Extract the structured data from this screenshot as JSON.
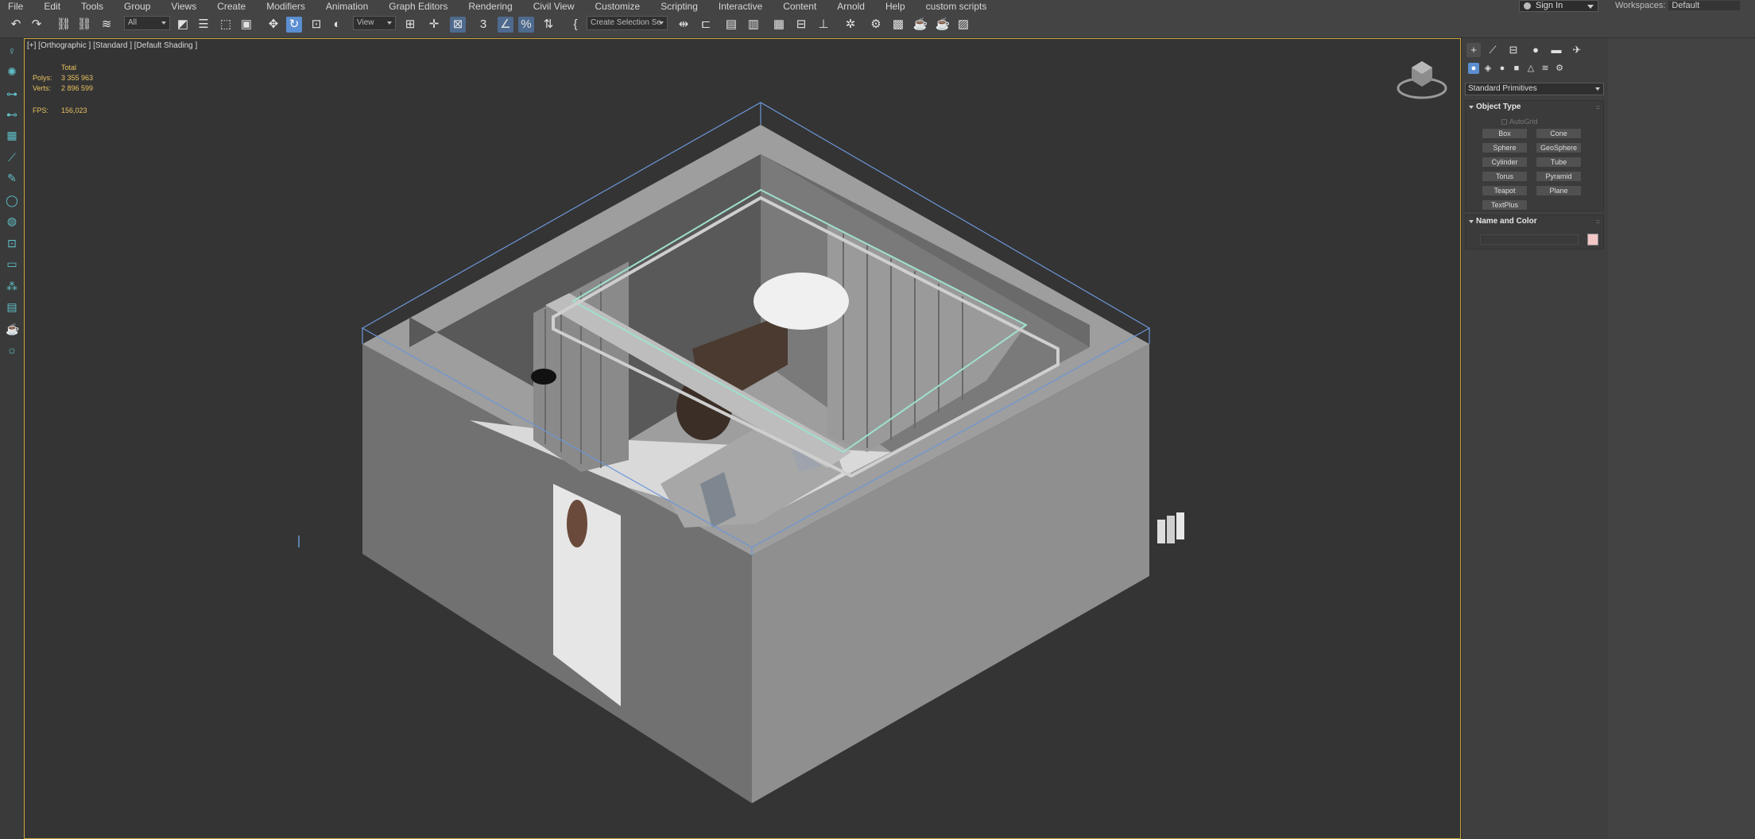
{
  "menu": [
    "File",
    "Edit",
    "Tools",
    "Group",
    "Views",
    "Create",
    "Modifiers",
    "Animation",
    "Graph Editors",
    "Rendering",
    "Civil View",
    "Customize",
    "Scripting",
    "Interactive",
    "Content",
    "Arnold",
    "Help",
    "custom scripts"
  ],
  "account": {
    "sign_in": "Sign In",
    "workspaces_label": "Workspaces:",
    "workspace_value": "Default"
  },
  "toolbar": {
    "filter_value": "All",
    "refcoord_value": "View",
    "selection_set_placeholder": "Create Selection Se"
  },
  "viewport": {
    "label": "[+] [Orthographic ] [Standard ] [Default Shading ]",
    "stats": {
      "total_label": "Total",
      "polys_label": "Polys:",
      "polys_value": "3 355 963",
      "verts_label": "Verts:",
      "verts_value": "2 896 599",
      "fps_label": "FPS:",
      "fps_value": "156,023"
    }
  },
  "command_panel": {
    "category": "Standard Primitives",
    "object_type": {
      "title": "Object Type",
      "autogrid_label": "AutoGrid",
      "buttons": [
        "Box",
        "Cone",
        "Sphere",
        "GeoSphere",
        "Cylinder",
        "Tube",
        "Torus",
        "Pyramid",
        "Teapot",
        "Plane",
        "TextPlus"
      ]
    },
    "name_and_color": {
      "title": "Name and Color",
      "name_value": "",
      "color": "#f4c6c6"
    }
  },
  "colors": {
    "active_tool": "#5b8fd1",
    "viewport_border": "#c8a43a",
    "stats_text": "#e8c160",
    "wire_blue": "#6b97d6"
  }
}
